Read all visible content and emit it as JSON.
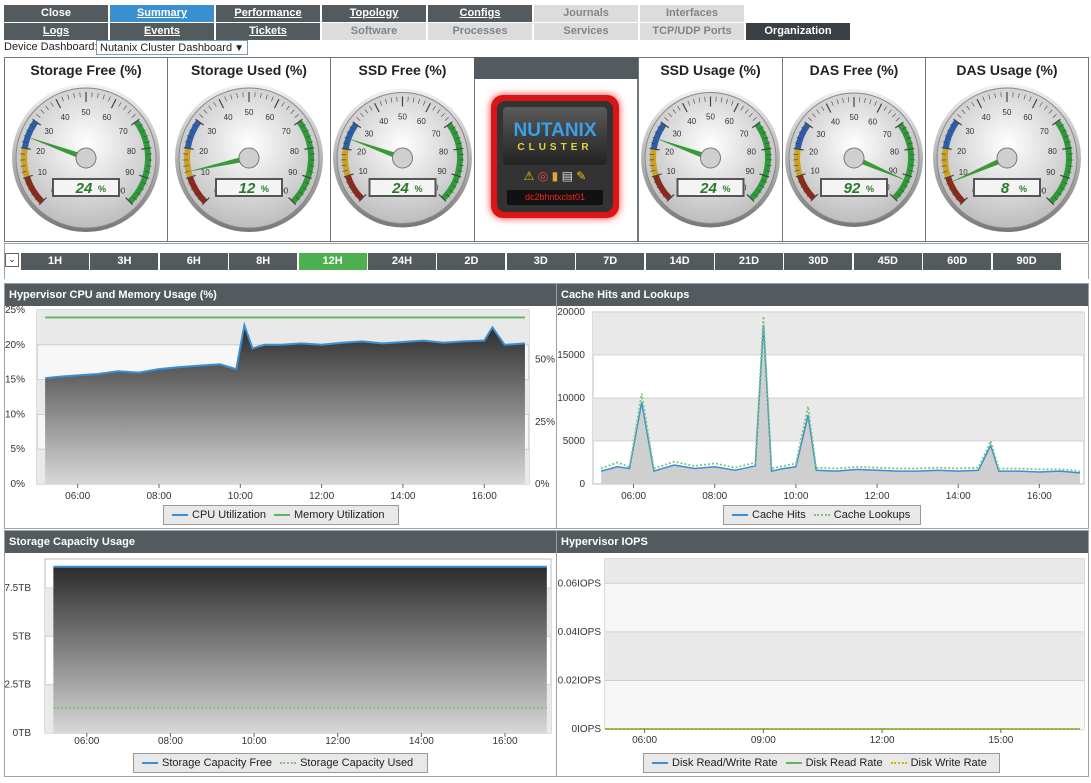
{
  "nav": {
    "row1": [
      {
        "label": "Close",
        "state": "normal"
      },
      {
        "label": "Summary",
        "state": "active",
        "underline": true
      },
      {
        "label": "Performance",
        "state": "normal",
        "underline": true
      },
      {
        "label": "Topology",
        "state": "normal",
        "underline": true
      },
      {
        "label": "Configs",
        "state": "normal",
        "underline": true
      },
      {
        "label": "Journals",
        "state": "disabled"
      },
      {
        "label": "Interfaces",
        "state": "disabled"
      }
    ],
    "row2": [
      {
        "label": "Logs",
        "state": "normal",
        "underline": true
      },
      {
        "label": "Events",
        "state": "normal",
        "underline": true
      },
      {
        "label": "Tickets",
        "state": "normal",
        "underline": true
      },
      {
        "label": "Software",
        "state": "disabled"
      },
      {
        "label": "Processes",
        "state": "disabled"
      },
      {
        "label": "Services",
        "state": "disabled"
      },
      {
        "label": "TCP/UDP Ports",
        "state": "disabled"
      },
      {
        "label": "Organization",
        "state": "org"
      }
    ]
  },
  "device_dashboard": {
    "label": "Device Dashboard:",
    "selected": "Nutanix Cluster Dashboard"
  },
  "gauges": [
    {
      "title": "Storage Free (%)",
      "value": 24,
      "display": "24",
      "unit": "%",
      "ticks": [
        "0",
        "10",
        "20",
        "30",
        "40",
        "50",
        "60",
        "70",
        "80",
        "90",
        "100"
      ]
    },
    {
      "title": "Storage Used (%)",
      "value": 12,
      "display": "12",
      "unit": "%",
      "ticks": [
        "0",
        "10",
        "20",
        "30",
        "40",
        "50",
        "60",
        "70",
        "80",
        "90",
        "100"
      ]
    },
    {
      "title": "SSD Free (%)",
      "value": 24,
      "display": "24",
      "unit": "%",
      "ticks": [
        "0",
        "10",
        "20",
        "30",
        "40",
        "50",
        "60",
        "70",
        "80",
        "90",
        "100"
      ]
    },
    {
      "title": "SSD Usage (%)",
      "value": 24,
      "display": "24",
      "unit": "%",
      "ticks": [
        "0",
        "10",
        "20",
        "30",
        "40",
        "50",
        "60",
        "70",
        "80",
        "90",
        "100"
      ]
    },
    {
      "title": "DAS Free (%)",
      "value": 92,
      "display": "92",
      "unit": "%",
      "ticks": [
        "0",
        "10",
        "20",
        "30",
        "40",
        "50",
        "60",
        "70",
        "80",
        "90",
        "100"
      ]
    },
    {
      "title": "DAS Usage (%)",
      "value": 8,
      "display": "8",
      "unit": "%",
      "ticks": [
        "0",
        "10",
        "20",
        "30",
        "40",
        "50",
        "60",
        "70",
        "80",
        "90",
        "100"
      ]
    }
  ],
  "device_card": {
    "logo_top": "NUTANIX",
    "logo_bottom": "CLUSTER",
    "device_name": "dc2bhntxclst01",
    "icons": [
      "warning-icon",
      "lifebuoy-icon",
      "bar-chart-icon",
      "printer-icon",
      "wrench-icon"
    ]
  },
  "time_ranges": {
    "selected": "12H",
    "items": [
      "1H",
      "3H",
      "6H",
      "8H",
      "12H",
      "24H",
      "2D",
      "3D",
      "7D",
      "14D",
      "21D",
      "30D",
      "45D",
      "60D",
      "90D"
    ]
  },
  "charts": {
    "cpu": {
      "title": "Hypervisor CPU and Memory Usage (%)",
      "legend": [
        {
          "label": "CPU Utilization",
          "color": "#3a8fd1",
          "style": "solid"
        },
        {
          "label": "Memory Utilization",
          "color": "#5cb85c",
          "style": "solid"
        }
      ]
    },
    "cache": {
      "title": "Cache Hits and Lookups",
      "legend": [
        {
          "label": "Cache Hits",
          "color": "#3a8fd1",
          "style": "solid"
        },
        {
          "label": "Cache Lookups",
          "color": "#7cc47c",
          "style": "dotted"
        }
      ]
    },
    "storage": {
      "title": "Storage Capacity Usage",
      "legend": [
        {
          "label": "Storage Capacity Free",
          "color": "#3a8fd1",
          "style": "solid"
        },
        {
          "label": "Storage Capacity Used",
          "color": "#7cc47c",
          "style": "dotted"
        }
      ]
    },
    "iops": {
      "title": "Hypervisor IOPS",
      "legend": [
        {
          "label": "Disk Read/Write Rate",
          "color": "#3a8fd1",
          "style": "solid"
        },
        {
          "label": "Disk Read Rate",
          "color": "#5cb85c",
          "style": "solid"
        },
        {
          "label": "Disk Write Rate",
          "color": "#e0b000",
          "style": "dotted"
        }
      ]
    }
  },
  "chart_data": [
    {
      "type": "area",
      "title": "Hypervisor CPU and Memory Usage (%)",
      "x": [
        "05:12",
        "06:00",
        "08:00",
        "10:00",
        "12:00",
        "14:00",
        "16:00",
        "17:05"
      ],
      "x_ticks": [
        "06:00",
        "08:00",
        "10:00",
        "12:00",
        "14:00",
        "16:00"
      ],
      "y_left_ticks": [
        "0%",
        "5%",
        "10%",
        "15%",
        "20%",
        "25%"
      ],
      "y_right_ticks": [
        "0%",
        "25%",
        "50%"
      ],
      "ylim_left": [
        0,
        25
      ],
      "ylim_right": [
        0,
        70
      ],
      "series": [
        {
          "name": "CPU Utilization",
          "axis": "left",
          "x_hours": [
            5.2,
            5.5,
            6.0,
            6.5,
            7.0,
            7.5,
            8.0,
            8.5,
            9.0,
            9.5,
            9.9,
            10.1,
            10.3,
            10.6,
            11.0,
            11.5,
            12.0,
            12.5,
            13.0,
            13.5,
            14.0,
            14.5,
            15.0,
            15.5,
            16.0,
            16.2,
            16.5,
            17.0
          ],
          "values": [
            15.2,
            15.4,
            15.6,
            15.8,
            16.2,
            16.0,
            16.5,
            16.8,
            17.0,
            17.2,
            16.5,
            22.8,
            19.5,
            20.0,
            20.0,
            20.2,
            20.0,
            20.3,
            20.5,
            20.2,
            20.4,
            20.6,
            20.3,
            20.5,
            20.6,
            22.5,
            20.0,
            20.2
          ]
        },
        {
          "name": "Memory Utilization",
          "axis": "right",
          "x_hours": [
            5.2,
            17.0
          ],
          "values": [
            67,
            67
          ]
        }
      ]
    },
    {
      "type": "line",
      "title": "Cache Hits and Lookups",
      "x_ticks": [
        "06:00",
        "08:00",
        "10:00",
        "12:00",
        "14:00",
        "16:00"
      ],
      "y_ticks": [
        "0",
        "5000",
        "10000",
        "15000",
        "20000"
      ],
      "ylim": [
        0,
        20000
      ],
      "series": [
        {
          "name": "Cache Hits",
          "x_hours": [
            5.2,
            5.6,
            5.9,
            6.2,
            6.5,
            7.0,
            7.5,
            8.0,
            8.5,
            9.0,
            9.2,
            9.4,
            9.7,
            10.0,
            10.3,
            10.5,
            11.0,
            11.5,
            12.0,
            12.5,
            13.0,
            13.5,
            14.0,
            14.5,
            14.8,
            15.0,
            15.5,
            16.0,
            16.5,
            17.0
          ],
          "values": [
            1500,
            2000,
            1800,
            9500,
            1500,
            2200,
            1800,
            2000,
            1600,
            2100,
            18500,
            1500,
            1800,
            2000,
            8000,
            1600,
            1500,
            1700,
            1600,
            1500,
            1500,
            1600,
            1500,
            1600,
            4500,
            1500,
            1500,
            1400,
            1500,
            1300
          ]
        },
        {
          "name": "Cache Lookups",
          "x_hours": [
            5.2,
            5.6,
            5.9,
            6.2,
            6.5,
            7.0,
            7.5,
            8.0,
            8.5,
            9.0,
            9.2,
            9.4,
            9.7,
            10.0,
            10.3,
            10.5,
            11.0,
            11.5,
            12.0,
            12.5,
            13.0,
            13.5,
            14.0,
            14.5,
            14.8,
            15.0,
            15.5,
            16.0,
            16.5,
            17.0
          ],
          "values": [
            1800,
            2500,
            2000,
            10500,
            1800,
            2600,
            2100,
            2400,
            1900,
            2500,
            19500,
            1800,
            2100,
            2400,
            9000,
            1900,
            1800,
            2000,
            1900,
            1800,
            1800,
            1900,
            1800,
            1900,
            5000,
            1800,
            1800,
            1700,
            1700,
            1500
          ]
        }
      ]
    },
    {
      "type": "area",
      "title": "Storage Capacity Usage",
      "x_ticks": [
        "06:00",
        "08:00",
        "10:00",
        "12:00",
        "14:00",
        "16:00"
      ],
      "y_ticks": [
        "0TB",
        "2.5TB",
        "5TB",
        "7.5TB"
      ],
      "ylim": [
        0,
        9
      ],
      "series": [
        {
          "name": "Storage Capacity Free",
          "x_hours": [
            5.2,
            17.0
          ],
          "values": [
            8.6,
            8.6
          ]
        },
        {
          "name": "Storage Capacity Used",
          "x_hours": [
            5.2,
            17.0
          ],
          "values": [
            1.3,
            1.3
          ]
        }
      ]
    },
    {
      "type": "line",
      "title": "Hypervisor IOPS",
      "x_ticks": [
        "06:00",
        "09:00",
        "12:00",
        "15:00"
      ],
      "y_ticks": [
        "0IOPS",
        "0.02IOPS",
        "0.04IOPS",
        "0.06IOPS"
      ],
      "ylim": [
        0,
        0.07
      ],
      "series": [
        {
          "name": "Disk Read/Write Rate",
          "x_hours": [
            5.0,
            17.0
          ],
          "values": [
            0,
            0
          ]
        },
        {
          "name": "Disk Read Rate",
          "x_hours": [
            5.0,
            17.0
          ],
          "values": [
            0,
            0
          ]
        },
        {
          "name": "Disk Write Rate",
          "x_hours": [
            5.0,
            17.0
          ],
          "values": [
            0,
            0
          ]
        }
      ]
    }
  ]
}
